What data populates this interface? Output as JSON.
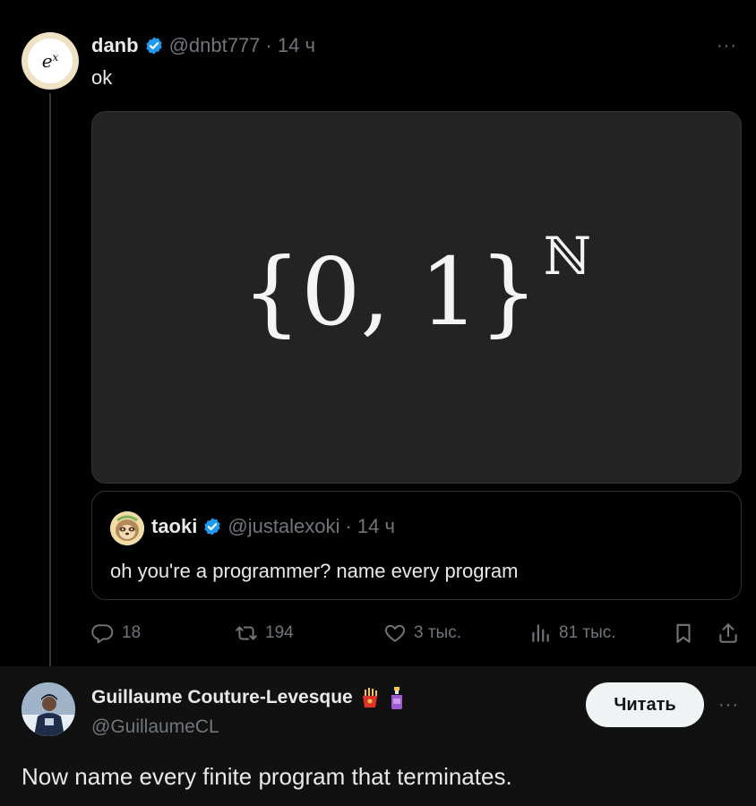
{
  "tweet": {
    "author_name": "danb",
    "handle": "@dnbt777",
    "time": "· 14 ч",
    "text": "ok",
    "media": {
      "formula_base": "{0, 1}",
      "formula_sup": "ℕ"
    },
    "more": "···"
  },
  "quote": {
    "author_name": "taoki",
    "handle": "@justalexoki",
    "time": "· 14 ч",
    "text": "oh you're a programmer? name every program"
  },
  "actions": {
    "replies": "18",
    "reposts": "194",
    "likes": "3 тыс.",
    "views": "81 тыс."
  },
  "reply": {
    "author_name": "Guillaume Couture-Levesque",
    "handle": "@GuillaumeCL",
    "follow_label": "Читать",
    "text": "Now name every finite program that terminates.",
    "more": "···"
  },
  "colors": {
    "verified": "#1d9bf0",
    "muted": "#71767b",
    "text": "#e7e9ea",
    "border": "#2f3336"
  }
}
